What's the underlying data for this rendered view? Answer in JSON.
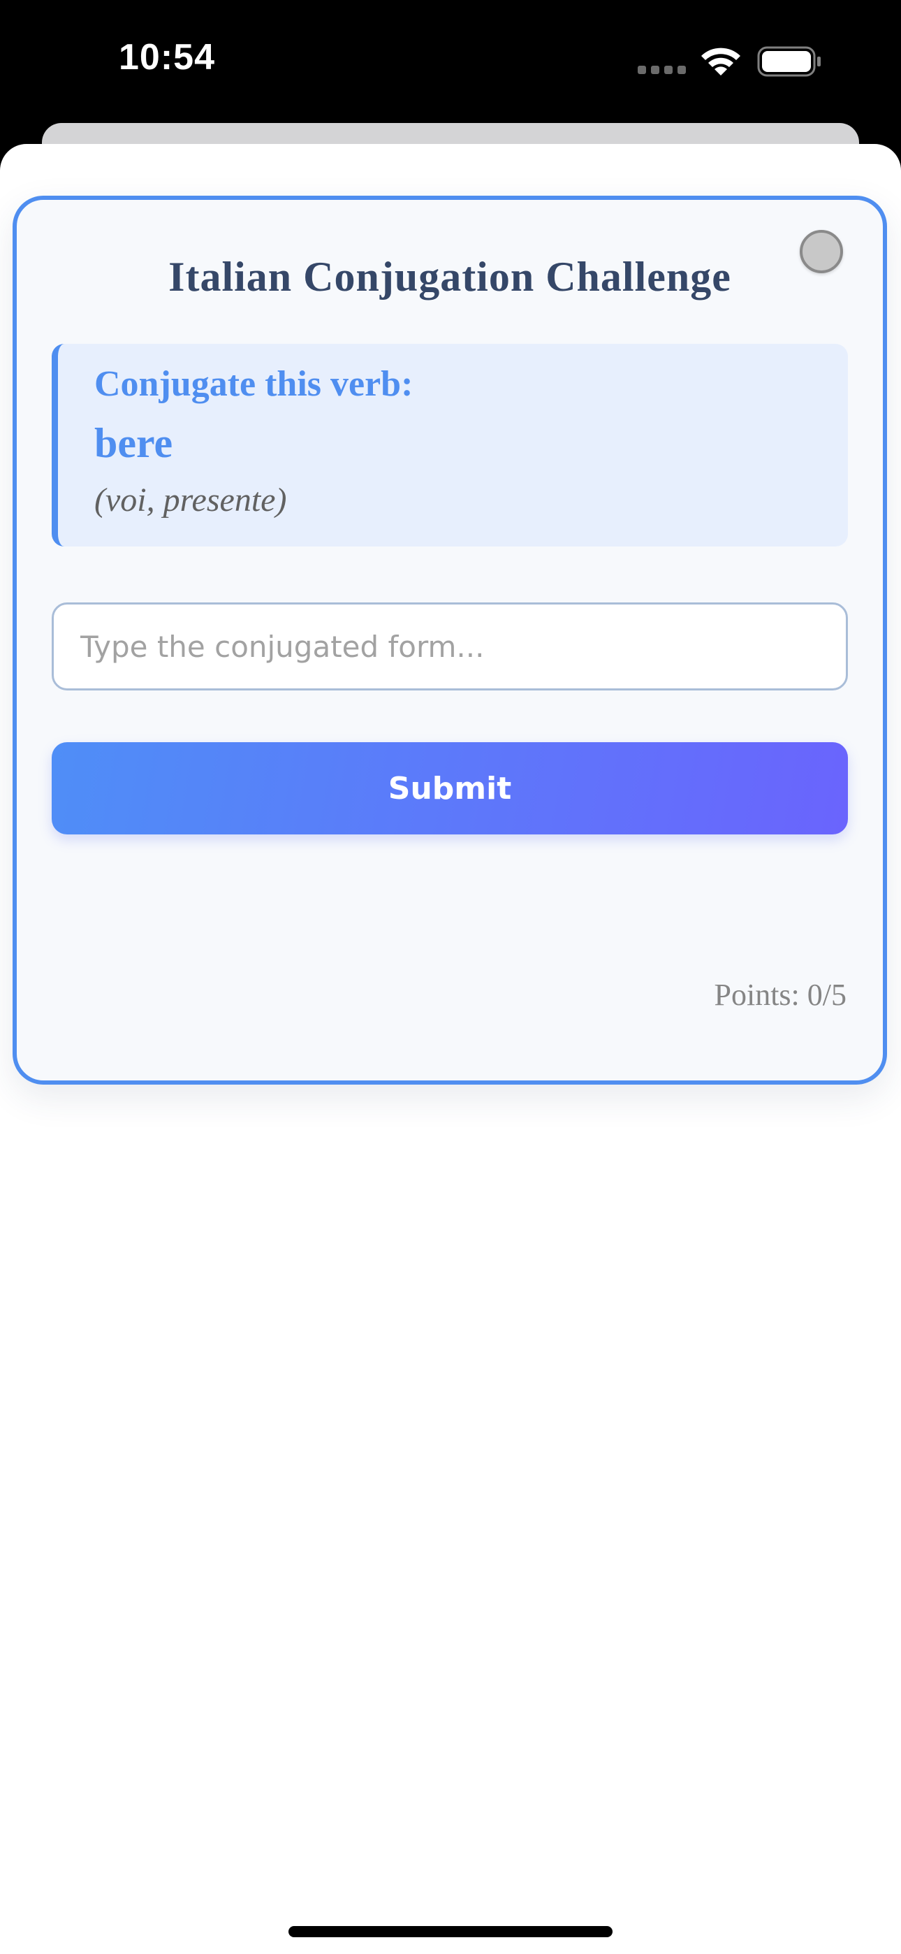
{
  "status_bar": {
    "time": "10:54",
    "icons": [
      "signal-dots-icon",
      "wifi-icon",
      "battery-icon"
    ]
  },
  "card": {
    "title": "Italian Conjugation Challenge",
    "prompt": {
      "label": "Conjugate this verb:",
      "verb": "bere",
      "context": "(voi, presente)"
    },
    "answer_input": {
      "value": "",
      "placeholder": "Type the conjugated form..."
    },
    "submit_label": "Submit",
    "points_text": "Points: 0/5"
  },
  "colors": {
    "accent": "#4f8ef0",
    "title": "#354768",
    "button_gradient_start": "#4f8ef7",
    "button_gradient_end": "#6a64fd",
    "prompt_background": "#e7effd"
  }
}
